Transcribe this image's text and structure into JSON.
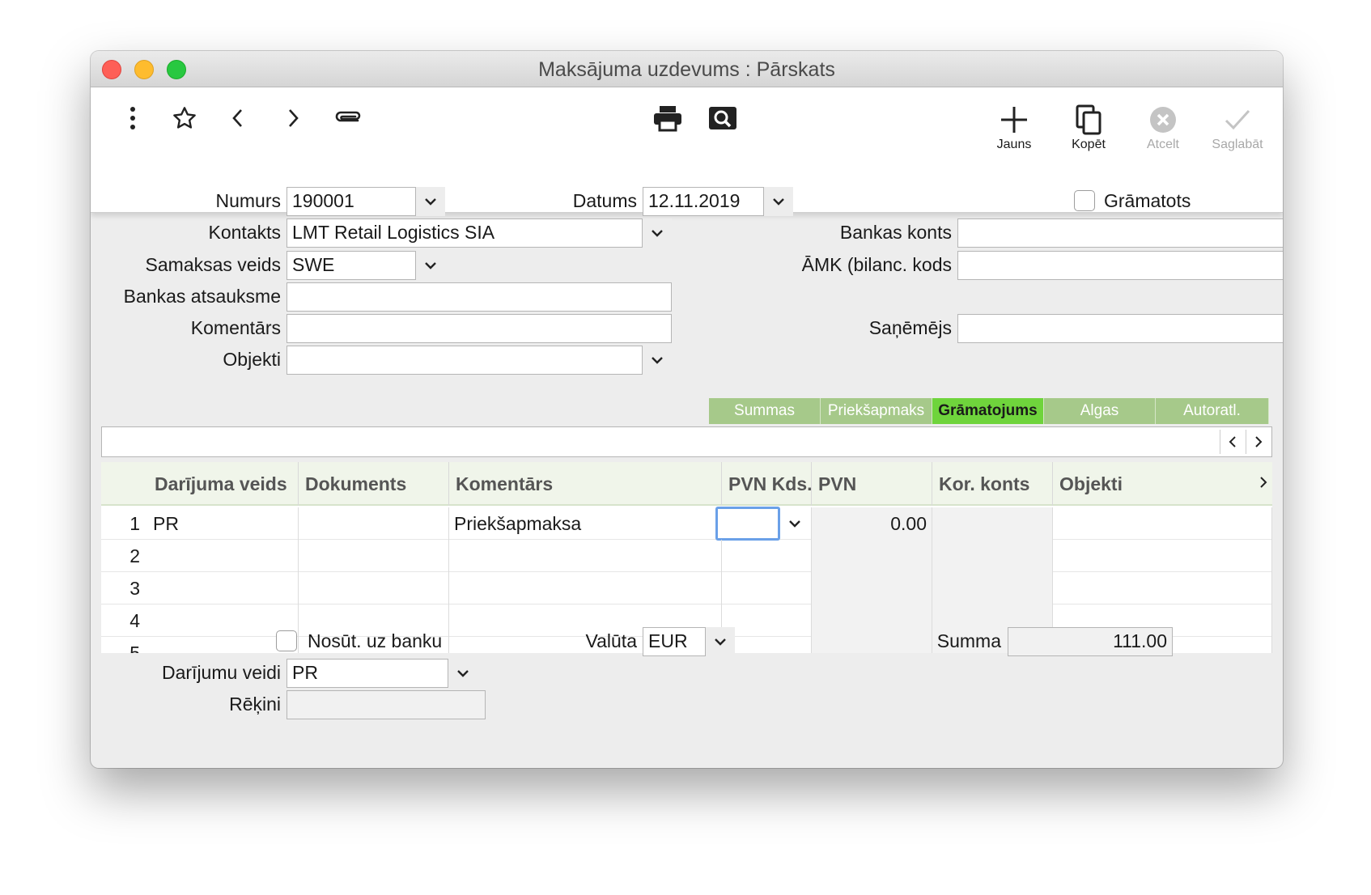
{
  "window": {
    "title": "Maksājuma uzdevums : Pārskats"
  },
  "toolbar": {
    "left_icons": [
      "more-vertical-icon",
      "star-icon",
      "chevron-left-icon",
      "chevron-right-icon",
      "paperclip-icon"
    ],
    "center_icons": [
      "printer-icon",
      "preview-icon"
    ],
    "new_label": "Jauns",
    "copy_label": "Kopēt",
    "cancel_label": "Atcelt",
    "save_label": "Saglabāt"
  },
  "form": {
    "numurs": {
      "label": "Numurs",
      "value": "190001"
    },
    "datums": {
      "label": "Datums",
      "value": "12.11.2019"
    },
    "gramatots": {
      "label": "Grāmatots",
      "checked": false
    },
    "kontakts": {
      "label": "Kontakts",
      "value": "LMT Retail  Logistics SIA"
    },
    "bankas_konts": {
      "label": "Bankas konts",
      "value": ""
    },
    "samaksas_veids": {
      "label": "Samaksas veids",
      "value": "SWE"
    },
    "amk": {
      "label": "ĀMK (bilanc. kods",
      "value": ""
    },
    "bankas_atsauksme": {
      "label": "Bankas atsauksme",
      "value": ""
    },
    "komentars": {
      "label": "Komentārs",
      "value": ""
    },
    "sanemejs": {
      "label": "Saņēmējs",
      "value": ""
    },
    "objekti": {
      "label": "Objekti",
      "value": ""
    }
  },
  "tabs": [
    {
      "label": "Summas",
      "active": false
    },
    {
      "label": "Priekšapmaks",
      "active": false
    },
    {
      "label": "Grāmatojums",
      "active": true
    },
    {
      "label": "Algas",
      "active": false
    },
    {
      "label": "Autoratl.",
      "active": false
    }
  ],
  "grid": {
    "columns": [
      "Darījuma veids",
      "Dokuments",
      "Komentārs",
      "PVN Kds.",
      "PVN",
      "Kor. konts",
      "Objekti"
    ],
    "rows": [
      {
        "num": "1",
        "darijuma_veids": "PR",
        "dokuments": "",
        "komentars": "Priekšapmaksa",
        "pvn_kds": "",
        "pvn": "0.00",
        "kor_konts": "",
        "objekti": ""
      },
      {
        "num": "2",
        "darijuma_veids": "",
        "dokuments": "",
        "komentars": "",
        "pvn_kds": "",
        "pvn": "",
        "kor_konts": "",
        "objekti": ""
      },
      {
        "num": "3",
        "darijuma_veids": "",
        "dokuments": "",
        "komentars": "",
        "pvn_kds": "",
        "pvn": "",
        "kor_konts": "",
        "objekti": ""
      },
      {
        "num": "4",
        "darijuma_veids": "",
        "dokuments": "",
        "komentars": "",
        "pvn_kds": "",
        "pvn": "",
        "kor_konts": "",
        "objekti": ""
      },
      {
        "num": "5",
        "darijuma_veids": "",
        "dokuments": "",
        "komentars": "",
        "pvn_kds": "",
        "pvn": "",
        "kor_konts": "",
        "objekti": ""
      }
    ]
  },
  "footer": {
    "nosut": {
      "label": "Nosūt. uz banku",
      "checked": false
    },
    "valuta": {
      "label": "Valūta",
      "value": "EUR"
    },
    "summa": {
      "label": "Summa",
      "value": "111.00"
    },
    "darijumu_veidi": {
      "label": "Darījumu veidi",
      "value": "PR"
    },
    "rekini": {
      "label": "Rēķini",
      "value": ""
    }
  },
  "colors": {
    "tab_bg": "#a6c98a",
    "tab_active": "#6fd43c",
    "header_bg": "#f0f5ea",
    "focus": "#6aa0e8"
  }
}
